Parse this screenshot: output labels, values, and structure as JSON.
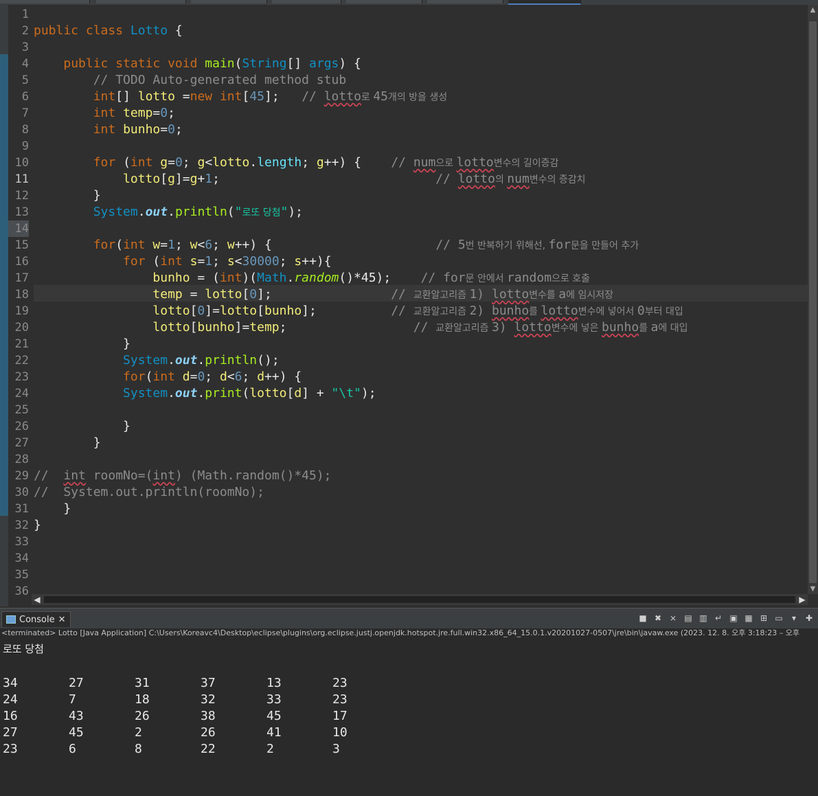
{
  "editor": {
    "lines": [
      {
        "n": "1",
        "segs": []
      },
      {
        "n": "2",
        "segs": [
          [
            "kw",
            "public "
          ],
          [
            "kw",
            "class "
          ],
          [
            "ty",
            "Lotto "
          ],
          [
            "",
            "{"
          ]
        ]
      },
      {
        "n": "3",
        "segs": []
      },
      {
        "n": "4",
        "segs": [
          [
            "",
            "    "
          ],
          [
            "kw",
            "public "
          ],
          [
            "kw",
            "static "
          ],
          [
            "kw",
            "void "
          ],
          [
            "fn",
            "main"
          ],
          [
            "",
            "("
          ],
          [
            "ty",
            "String"
          ],
          [
            "",
            "[] "
          ],
          [
            "ty",
            "args"
          ],
          [
            "",
            ") {"
          ]
        ]
      },
      {
        "n": "5",
        "segs": [
          [
            "",
            "        "
          ],
          [
            "cmt",
            "// TODO Auto-generated method stub"
          ]
        ]
      },
      {
        "n": "6",
        "segs": [
          [
            "",
            "        "
          ],
          [
            "kw",
            "int"
          ],
          [
            "",
            "[] "
          ],
          [
            "var",
            "lotto "
          ],
          [
            "",
            "="
          ],
          [
            "kw",
            "new "
          ],
          [
            "kw",
            "int"
          ],
          [
            "",
            "["
          ],
          [
            "num",
            "45"
          ],
          [
            "",
            "];   "
          ],
          [
            "cmt",
            "// "
          ],
          [
            "cmt sq",
            "lotto"
          ],
          [
            "cmt hangul",
            "로 "
          ],
          [
            "cmt",
            "45"
          ],
          [
            "cmt hangul",
            "개의 방을 생성"
          ]
        ]
      },
      {
        "n": "7",
        "segs": [
          [
            "",
            "        "
          ],
          [
            "kw",
            "int "
          ],
          [
            "var",
            "temp"
          ],
          [
            "",
            "="
          ],
          [
            "num",
            "0"
          ],
          [
            "",
            ";"
          ]
        ]
      },
      {
        "n": "8",
        "segs": [
          [
            "",
            "        "
          ],
          [
            "kw",
            "int "
          ],
          [
            "var",
            "bunho"
          ],
          [
            "",
            "="
          ],
          [
            "num",
            "0"
          ],
          [
            "",
            ";"
          ]
        ]
      },
      {
        "n": "9",
        "segs": []
      },
      {
        "n": "10",
        "segs": [
          [
            "",
            "        "
          ],
          [
            "kw",
            "for "
          ],
          [
            "",
            "("
          ],
          [
            "kw",
            "int "
          ],
          [
            "var",
            "g"
          ],
          [
            "",
            "="
          ],
          [
            "num",
            "0"
          ],
          [
            "",
            "; "
          ],
          [
            "var",
            "g"
          ],
          [
            "",
            "<"
          ],
          [
            "var",
            "lotto"
          ],
          [
            "",
            "."
          ],
          [
            "fld",
            "length"
          ],
          [
            "",
            "; "
          ],
          [
            "var",
            "g"
          ],
          [
            "",
            "++) {    "
          ],
          [
            "cmt",
            "// "
          ],
          [
            "cmt sq",
            "num"
          ],
          [
            "cmt hangul",
            "으로 "
          ],
          [
            "cmt sq",
            "lotto"
          ],
          [
            "cmt hangul",
            "변수의 길이증감"
          ]
        ]
      },
      {
        "n": "11",
        "segs": [
          [
            "",
            "            "
          ],
          [
            "var",
            "lotto"
          ],
          [
            "",
            "["
          ],
          [
            "var",
            "g"
          ],
          [
            "",
            "]="
          ],
          [
            "var",
            "g"
          ],
          [
            "",
            "+"
          ],
          [
            "num",
            "1"
          ],
          [
            "",
            ";                             "
          ],
          [
            "cmt",
            "// "
          ],
          [
            "cmt sq",
            "lotto"
          ],
          [
            "cmt hangul",
            "의 "
          ],
          [
            "cmt sq",
            "num"
          ],
          [
            "cmt hangul",
            "변수의 증감치"
          ]
        ]
      },
      {
        "n": "12",
        "segs": [
          [
            "",
            "        }"
          ]
        ]
      },
      {
        "n": "13",
        "segs": [
          [
            "",
            "        "
          ],
          [
            "ty",
            "System"
          ],
          [
            "",
            "."
          ],
          [
            "sf",
            "out"
          ],
          [
            "",
            "."
          ],
          [
            "fn",
            "println"
          ],
          [
            "",
            "("
          ],
          [
            "str",
            "\""
          ],
          [
            "str hangul",
            "로또 당첨"
          ],
          [
            "str",
            "\""
          ],
          [
            "",
            ");"
          ]
        ]
      },
      {
        "n": "14",
        "segs": []
      },
      {
        "n": "15",
        "segs": [
          [
            "",
            "        "
          ],
          [
            "kw",
            "for"
          ],
          [
            "",
            "("
          ],
          [
            "kw",
            "int "
          ],
          [
            "var",
            "w"
          ],
          [
            "",
            "="
          ],
          [
            "num",
            "1"
          ],
          [
            "",
            "; "
          ],
          [
            "var",
            "w"
          ],
          [
            "",
            "<"
          ],
          [
            "num",
            "6"
          ],
          [
            "",
            "; "
          ],
          [
            "var",
            "w"
          ],
          [
            "",
            "++) {                      "
          ],
          [
            "cmt",
            "// 5"
          ],
          [
            "cmt hangul",
            "번 반복하기 위해선, "
          ],
          [
            "cmt",
            "for"
          ],
          [
            "cmt hangul",
            "문을 만들어 추가"
          ]
        ]
      },
      {
        "n": "16",
        "segs": [
          [
            "",
            "            "
          ],
          [
            "kw",
            "for "
          ],
          [
            "",
            "("
          ],
          [
            "kw",
            "int "
          ],
          [
            "var",
            "s"
          ],
          [
            "",
            "="
          ],
          [
            "num",
            "1"
          ],
          [
            "",
            "; "
          ],
          [
            "var",
            "s"
          ],
          [
            "",
            "<"
          ],
          [
            "num",
            "30000"
          ],
          [
            "",
            "; "
          ],
          [
            "var",
            "s"
          ],
          [
            "",
            "++){"
          ]
        ]
      },
      {
        "n": "17",
        "segs": [
          [
            "",
            "                "
          ],
          [
            "var",
            "bunho "
          ],
          [
            "",
            "= ("
          ],
          [
            "kw",
            "int"
          ],
          [
            "",
            ")("
          ],
          [
            "ty",
            "Math"
          ],
          [
            "",
            "."
          ],
          [
            "mth",
            "random"
          ],
          [
            "",
            "()*45);    "
          ],
          [
            "cmt",
            "// for"
          ],
          [
            "cmt hangul",
            "문 안에서 "
          ],
          [
            "cmt",
            "random"
          ],
          [
            "cmt hangul",
            "으로 호출"
          ]
        ]
      },
      {
        "n": "18",
        "segs": [
          [
            "",
            "                "
          ],
          [
            "var",
            "temp "
          ],
          [
            "",
            "= "
          ],
          [
            "var",
            "lotto"
          ],
          [
            "",
            "["
          ],
          [
            "num",
            "0"
          ],
          [
            "",
            "];                "
          ],
          [
            "cmt",
            "// "
          ],
          [
            "cmt hangul",
            "교환알고리즘 "
          ],
          [
            "cmt",
            "1) "
          ],
          [
            "cmt sq",
            "lotto"
          ],
          [
            "cmt hangul",
            "변수를 "
          ],
          [
            "cmt",
            "a"
          ],
          [
            "cmt hangul",
            "에 임시저장"
          ]
        ]
      },
      {
        "n": "19",
        "segs": [
          [
            "",
            "                "
          ],
          [
            "var",
            "lotto"
          ],
          [
            "",
            "["
          ],
          [
            "num",
            "0"
          ],
          [
            "",
            "]="
          ],
          [
            "var",
            "lotto"
          ],
          [
            "",
            "["
          ],
          [
            "var",
            "bunho"
          ],
          [
            "",
            "];          "
          ],
          [
            "cmt",
            "// "
          ],
          [
            "cmt hangul",
            "교환알고리즘 "
          ],
          [
            "cmt",
            "2) "
          ],
          [
            "cmt sq",
            "bunho"
          ],
          [
            "cmt hangul",
            "를 "
          ],
          [
            "cmt sq",
            "lotto"
          ],
          [
            "cmt hangul",
            "변수에 넣어서 "
          ],
          [
            "cmt",
            "0"
          ],
          [
            "cmt hangul",
            "부터 대입"
          ]
        ]
      },
      {
        "n": "20",
        "segs": [
          [
            "",
            "                "
          ],
          [
            "var",
            "lotto"
          ],
          [
            "",
            "["
          ],
          [
            "var",
            "bunho"
          ],
          [
            "",
            "]="
          ],
          [
            "var",
            "temp"
          ],
          [
            "",
            ";                 "
          ],
          [
            "cmt",
            "// "
          ],
          [
            "cmt hangul",
            "교환알고리즘 "
          ],
          [
            "cmt",
            "3) "
          ],
          [
            "cmt sq",
            "lotto"
          ],
          [
            "cmt hangul",
            "변수에 넣은 "
          ],
          [
            "cmt sq",
            "bunho"
          ],
          [
            "cmt hangul",
            "를 "
          ],
          [
            "cmt",
            "a"
          ],
          [
            "cmt hangul",
            "에 대입"
          ]
        ]
      },
      {
        "n": "21",
        "segs": [
          [
            "",
            "            }"
          ]
        ]
      },
      {
        "n": "22",
        "segs": [
          [
            "",
            "            "
          ],
          [
            "ty",
            "System"
          ],
          [
            "",
            "."
          ],
          [
            "sf",
            "out"
          ],
          [
            "",
            "."
          ],
          [
            "fn",
            "println"
          ],
          [
            "",
            "();"
          ]
        ]
      },
      {
        "n": "23",
        "segs": [
          [
            "",
            "            "
          ],
          [
            "kw",
            "for"
          ],
          [
            "",
            "("
          ],
          [
            "kw",
            "int "
          ],
          [
            "var",
            "d"
          ],
          [
            "",
            "="
          ],
          [
            "num",
            "0"
          ],
          [
            "",
            "; "
          ],
          [
            "var",
            "d"
          ],
          [
            "",
            "<"
          ],
          [
            "num",
            "6"
          ],
          [
            "",
            "; "
          ],
          [
            "var",
            "d"
          ],
          [
            "",
            "++) {"
          ]
        ]
      },
      {
        "n": "24",
        "segs": [
          [
            "",
            "            "
          ],
          [
            "ty",
            "System"
          ],
          [
            "",
            "."
          ],
          [
            "sf",
            "out"
          ],
          [
            "",
            "."
          ],
          [
            "fn",
            "print"
          ],
          [
            "",
            "("
          ],
          [
            "var",
            "lotto"
          ],
          [
            "",
            "["
          ],
          [
            "var",
            "d"
          ],
          [
            "",
            "] + "
          ],
          [
            "str",
            "\"\\t\""
          ],
          [
            "",
            ");"
          ]
        ]
      },
      {
        "n": "25",
        "segs": []
      },
      {
        "n": "26",
        "segs": [
          [
            "",
            "            }"
          ]
        ]
      },
      {
        "n": "27",
        "segs": [
          [
            "",
            "        }"
          ]
        ]
      },
      {
        "n": "28",
        "segs": []
      },
      {
        "n": "29",
        "segs": [
          [
            "cmt",
            "//  "
          ],
          [
            "cmt sq",
            "int"
          ],
          [
            "cmt",
            " roomNo=("
          ],
          [
            "cmt sq",
            "int"
          ],
          [
            "cmt",
            ") (Math.random()*45);"
          ]
        ]
      },
      {
        "n": "30",
        "segs": [
          [
            "cmt",
            "//  System.out.println(roomNo);"
          ]
        ]
      },
      {
        "n": "31",
        "segs": [
          [
            "",
            "    }"
          ]
        ]
      },
      {
        "n": "32",
        "segs": [
          [
            "",
            "}"
          ]
        ]
      },
      {
        "n": "33",
        "segs": []
      },
      {
        "n": "34",
        "segs": []
      },
      {
        "n": "35",
        "segs": []
      },
      {
        "n": "36",
        "segs": []
      }
    ]
  },
  "console": {
    "tab_label": "Console",
    "status": "<terminated> Lotto [Java Application] C:\\Users\\Koreavc4\\Desktop\\eclipse\\plugins\\org.eclipse.justj.openjdk.hotspot.jre.full.win32.x86_64_15.0.1.v20201027-0507\\jre\\bin\\javaw.exe  (2023. 12. 8. 오후 3:18:23 – 오후",
    "output_title": "로또 당첨",
    "rows": [
      [
        "34",
        "27",
        "31",
        "37",
        "13",
        "23"
      ],
      [
        "24",
        "7",
        "18",
        "32",
        "33",
        "23"
      ],
      [
        "16",
        "43",
        "26",
        "38",
        "45",
        "17"
      ],
      [
        "27",
        "45",
        "2",
        "26",
        "41",
        "10"
      ],
      [
        "23",
        "6",
        "8",
        "22",
        "2",
        "3"
      ]
    ]
  },
  "colors": {
    "keyword": "#cc6c1d",
    "type": "#1290c3",
    "comment": "#8c8c8c",
    "string": "#17c6a3"
  }
}
